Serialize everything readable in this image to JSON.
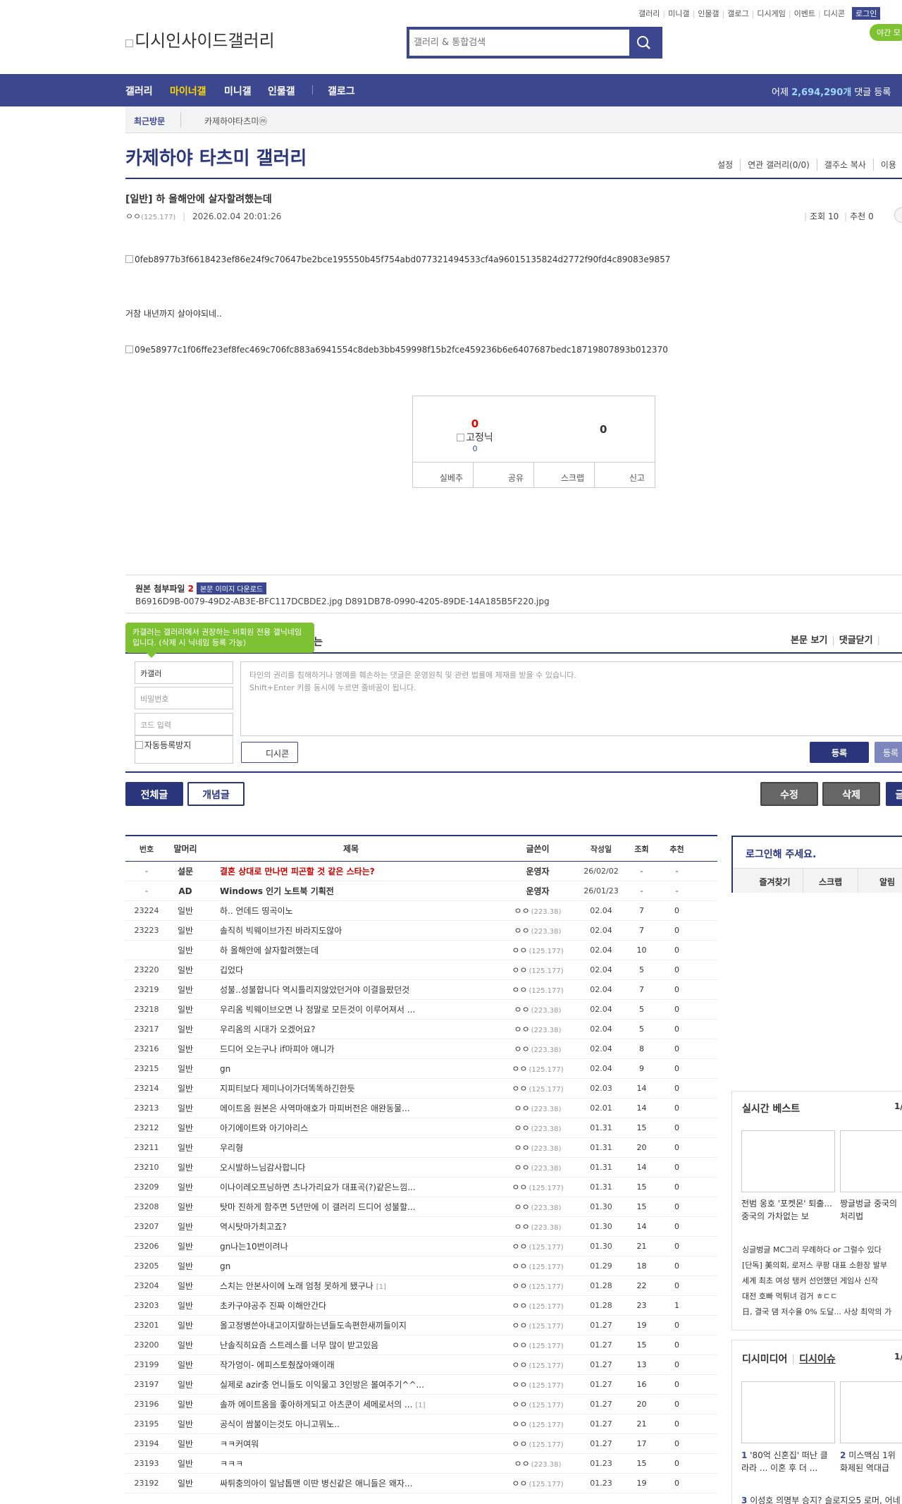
{
  "top_nav": {
    "items": [
      "갤러리",
      "미니갤",
      "인물갤",
      "갤로그",
      "디시게임",
      "이벤트",
      "디시콘"
    ],
    "login": "로그인",
    "night_mode": "야간 모"
  },
  "logo": {
    "alt": "디시인사이드갤러리"
  },
  "search": {
    "placeholder": "갤러리 & 통합검색"
  },
  "gnb": {
    "menus": [
      "갤러리",
      "마이너갤",
      "미니갤",
      "인물갤",
      "갤로그"
    ],
    "active": "마이너갤",
    "stat_prefix": "어제 ",
    "stat_value": "2,694,290개",
    "stat_suffix": " 댓글 등록"
  },
  "recent": {
    "label": "최근방문",
    "item": "카제하야타츠미ⓜ"
  },
  "gallery": {
    "title": "카제하야 타츠미 갤러리",
    "options": [
      "설정",
      "연관 갤러리(0/0)",
      "갤주소 복사",
      "이용"
    ]
  },
  "post": {
    "title": "[일반] 하 올해안에 살자할려했는데",
    "author": "ㅇㅇ",
    "author_ip": "(125.177)",
    "date": "2026.02.04 20:01:26",
    "views": "조회 10",
    "recommends": "추천 0",
    "image1_alt": "0feb8977b3f6618423ef86e24f9c70647be2bce195550b45f754abd077321494533cf4a96015135824d2772f90fd4c89083e9857",
    "body": "거참 내년까지 살아야되네..",
    "image2_alt": "09e58977c1f06ffe23ef8fec469c706fc883a6941554c8deb3bb459998f15b2fce459236b6e6407687bedc18719807893b012370"
  },
  "recommend_box": {
    "up": "0",
    "fixed_nick": "고정닉",
    "fixed_count": "0",
    "down": "0",
    "buttons": [
      "실베추",
      "공유",
      "스크랩",
      "신고"
    ]
  },
  "attachment": {
    "label": "원본 첨부파일",
    "count": "2",
    "download": "본문 이미지 다운로드",
    "files": "B6916D9B-0079-49D2-AB3E-BFC117DCBDE2.jpg  D891DB78-0990-4205-89DE-14A185B5F220.jpg"
  },
  "comment": {
    "tooltip": "카갤러는 갤러리에서 권장하는 비회원 전용 갤닉네임입니다. (삭제 시 닉네임 등록 가능)",
    "tooltip_tail": "는",
    "options": [
      "본문 보기",
      "댓글닫기"
    ],
    "name_value": "카갤러",
    "pw_placeholder": "비밀번호",
    "code_placeholder": "코드 입력",
    "captcha_alt": "자동등록방지",
    "text_placeholder_1": "타인의 권리를 침해하거나 명예를 훼손하는 댓글은 운영원칙 및 관련 법률에 제재를 받을 수 있습니다.",
    "text_placeholder_2": "Shift+Enter 키를 동시에 누르면 줄바꿈이 됩니다.",
    "dccon": "디시콘",
    "register": "등록",
    "register2": "등록"
  },
  "buttons": {
    "all": "전체글",
    "concept": "개념글",
    "edit": "수정",
    "delete": "삭제",
    "write": "글"
  },
  "list": {
    "headers": {
      "no": "번호",
      "head": "말머리",
      "title": "제목",
      "writer": "글쓴이",
      "date": "작성일",
      "views": "조회",
      "rec": "추천"
    },
    "rows": [
      {
        "no": "-",
        "head": "설문",
        "title": "결혼 상대로 만나면 피곤할 것 같은 스타는?",
        "writer": "운영자",
        "ip": "",
        "date": "26/02/02",
        "views": "-",
        "rec": "-",
        "notice": true,
        "red": true
      },
      {
        "no": "-",
        "head": "AD",
        "title": "Windows 인기 노트북 기획전",
        "writer": "운영자",
        "ip": "",
        "date": "26/01/23",
        "views": "-",
        "rec": "-",
        "notice": true
      },
      {
        "no": "23224",
        "head": "일반",
        "title": "하.. 언데드 띵곡이노",
        "writer": "ㅇㅇ",
        "ip": "(223.38)",
        "date": "02.04",
        "views": "7",
        "rec": "0"
      },
      {
        "no": "23223",
        "head": "일반",
        "title": "솔직히 빅웨이브가진 바라지도않아",
        "writer": "ㅇㅇ",
        "ip": "(223.38)",
        "date": "02.04",
        "views": "7",
        "rec": "0"
      },
      {
        "no": "",
        "head": "일반",
        "title": "하 올해안에 살자할려했는데",
        "writer": "ㅇㅇ",
        "ip": "(125.177)",
        "date": "02.04",
        "views": "10",
        "rec": "0"
      },
      {
        "no": "23220",
        "head": "일반",
        "title": "깁었다",
        "writer": "ㅇㅇ",
        "ip": "(125.177)",
        "date": "02.04",
        "views": "5",
        "rec": "0"
      },
      {
        "no": "23219",
        "head": "일반",
        "title": "성불..성불합니다 역시틀리지않았던거야 이결을팠던것",
        "writer": "ㅇㅇ",
        "ip": "(125.177)",
        "date": "02.04",
        "views": "7",
        "rec": "0"
      },
      {
        "no": "23218",
        "head": "일반",
        "title": "우리옴 빅웨이브오면 나 정말로 모든것이 이루어져서 ...",
        "writer": "ㅇㅇ",
        "ip": "(223.38)",
        "date": "02.04",
        "views": "5",
        "rec": "0"
      },
      {
        "no": "23217",
        "head": "일반",
        "title": "우리옴의 시대가 오겠어요?",
        "writer": "ㅇㅇ",
        "ip": "(223.38)",
        "date": "02.04",
        "views": "5",
        "rec": "0"
      },
      {
        "no": "23216",
        "head": "일반",
        "title": "드디어 오는구나 if마피아 애니가",
        "writer": "ㅇㅇ",
        "ip": "(223.38)",
        "date": "02.04",
        "views": "8",
        "rec": "0"
      },
      {
        "no": "23215",
        "head": "일반",
        "title": "gn",
        "writer": "ㅇㅇ",
        "ip": "(125.177)",
        "date": "02.04",
        "views": "9",
        "rec": "0"
      },
      {
        "no": "23214",
        "head": "일반",
        "title": "지피티보다 제미나이가더똑똑하긴한듯",
        "writer": "ㅇㅇ",
        "ip": "(125.177)",
        "date": "02.03",
        "views": "14",
        "rec": "0"
      },
      {
        "no": "23213",
        "head": "일반",
        "title": "에이트옴 원본은 사역마애호가 마피버전은 애완동물...",
        "writer": "ㅇㅇ",
        "ip": "(223.38)",
        "date": "02.01",
        "views": "14",
        "rec": "0"
      },
      {
        "no": "23212",
        "head": "일반",
        "title": "아기에이트와 아기아리스",
        "writer": "ㅇㅇ",
        "ip": "(223.38)",
        "date": "01.31",
        "views": "15",
        "rec": "0"
      },
      {
        "no": "23211",
        "head": "일반",
        "title": "우리형",
        "writer": "ㅇㅇ",
        "ip": "(223.38)",
        "date": "01.31",
        "views": "20",
        "rec": "0"
      },
      {
        "no": "23210",
        "head": "일반",
        "title": "오시발하느님감사합니다",
        "writer": "ㅇㅇ",
        "ip": "(223.38)",
        "date": "01.31",
        "views": "14",
        "rec": "0"
      },
      {
        "no": "23209",
        "head": "일반",
        "title": "이나이레오프닝하면 츠나가리요가 대표곡(?)같은느낌...",
        "writer": "ㅇㅇ",
        "ip": "(125.177)",
        "date": "01.31",
        "views": "15",
        "rec": "0"
      },
      {
        "no": "23208",
        "head": "일반",
        "title": "탓마 진하게 함주면 5년만에 이 갤러리 드디어 성불할...",
        "writer": "ㅇㅇ",
        "ip": "(223.38)",
        "date": "01.30",
        "views": "15",
        "rec": "0"
      },
      {
        "no": "23207",
        "head": "일반",
        "title": "역시탓마가최고죠?",
        "writer": "ㅇㅇ",
        "ip": "(223.38)",
        "date": "01.30",
        "views": "14",
        "rec": "0"
      },
      {
        "no": "23206",
        "head": "일반",
        "title": "gn나는10번이려나",
        "writer": "ㅇㅇ",
        "ip": "(125.177)",
        "date": "01.30",
        "views": "21",
        "rec": "0"
      },
      {
        "no": "23205",
        "head": "일반",
        "title": "gn",
        "writer": "ㅇㅇ",
        "ip": "(125.177)",
        "date": "01.29",
        "views": "18",
        "rec": "0"
      },
      {
        "no": "23204",
        "head": "일반",
        "title": "스치는 안본사이에 노래 엄청 못하게 됐구나",
        "writer": "ㅇㅇ",
        "ip": "(125.177)",
        "date": "01.28",
        "views": "22",
        "rec": "0",
        "cnt": "[1]"
      },
      {
        "no": "23203",
        "head": "일반",
        "title": "초카구야공주 진짜 이해안간다",
        "writer": "ㅇㅇ",
        "ip": "(125.177)",
        "date": "01.28",
        "views": "23",
        "rec": "1"
      },
      {
        "no": "23201",
        "head": "일반",
        "title": "올고정병쓴아내고이지랄하는년들도속편한새끼들이지",
        "writer": "ㅇㅇ",
        "ip": "(125.177)",
        "date": "01.27",
        "views": "19",
        "rec": "0"
      },
      {
        "no": "23200",
        "head": "일반",
        "title": "난솔직히요즘 스트레스를 너무 많이 받고있음",
        "writer": "ㅇㅇ",
        "ip": "(125.177)",
        "date": "01.27",
        "views": "15",
        "rec": "0"
      },
      {
        "no": "23199",
        "head": "일반",
        "title": "작가엉이- 에피스토췄잖아왜이래",
        "writer": "ㅇㅇ",
        "ip": "(125.177)",
        "date": "01.27",
        "views": "13",
        "rec": "0"
      },
      {
        "no": "23197",
        "head": "일반",
        "title": "실제로 azir충 언니들도 이익물고 3인방은 볼여주기^^...",
        "writer": "ㅇㅇ",
        "ip": "(125.177)",
        "date": "01.27",
        "views": "16",
        "rec": "0"
      },
      {
        "no": "23196",
        "head": "일반",
        "title": "솔까 에이트옴을 좋아하게되고 아츠쿤이 세메로서의 ...",
        "writer": "ㅇㅇ",
        "ip": "(125.177)",
        "date": "01.27",
        "views": "20",
        "rec": "0",
        "cnt": "[1]"
      },
      {
        "no": "23195",
        "head": "일반",
        "title": "공식이 쌈불이는것도 아니고뭐노..",
        "writer": "ㅇㅇ",
        "ip": "(125.177)",
        "date": "01.27",
        "views": "21",
        "rec": "0"
      },
      {
        "no": "23194",
        "head": "일반",
        "title": "ㅋㅋ커여워",
        "writer": "ㅇㅇ",
        "ip": "(125.177)",
        "date": "01.27",
        "views": "17",
        "rec": "0"
      },
      {
        "no": "23193",
        "head": "일반",
        "title": "ㅋㅋㅋ",
        "writer": "ㅇㅇ",
        "ip": "(223.38)",
        "date": "01.23",
        "views": "15",
        "rec": "0"
      },
      {
        "no": "23192",
        "head": "일반",
        "title": "싸튀충의아이 일남톱맨 이딴 병신같은 애니들은 왜자...",
        "writer": "ㅇㅇ",
        "ip": "(125.177)",
        "date": "01.23",
        "views": "19",
        "rec": "0"
      }
    ]
  },
  "sidebar": {
    "login_prompt": "로그인해 주세요.",
    "login_links": [
      "즐겨찾기",
      "스크랩",
      "알림"
    ],
    "best_title": "실시간 베스트",
    "best_page": "1/",
    "best_caps": [
      "전범 옹호 '포켓몬' 퇴출... 중국의 가차없는 보",
      "짱글벙글 중국의 처리법"
    ],
    "best_lines": [
      "싱글벙글 MC그리 무례하다 or 그럴수 있다",
      "[단독] 美의회, 로저스 쿠팡 대표 소환장 발부",
      "세계 최초 여성 탱커 선언했던 게임사 신작",
      "대전 호빠 먹튀녀 검거 ㅎㄷㄷ",
      "日, 결국 댐 저수율 0% 도달... 사상 최악의 가"
    ],
    "media_title_1": "디시미디어",
    "media_title_2": "디시이슈",
    "media_page": "1/",
    "media_caps": [
      {
        "n": "1",
        "t": "'80억 신혼집' 떠난 클라라 ... 이혼 후 더 ..."
      },
      {
        "n": "2",
        "t": "미스맥심 1위 화제된 역대급"
      }
    ],
    "media_line": {
      "n": "3",
      "t": "이성호 의명부 승지? 슬로지오5 로머, 어네"
    }
  },
  "colors": {
    "brand": "#3b4890",
    "brand_dark": "#29367c",
    "green": "#7dc233",
    "red": "#d00000"
  }
}
